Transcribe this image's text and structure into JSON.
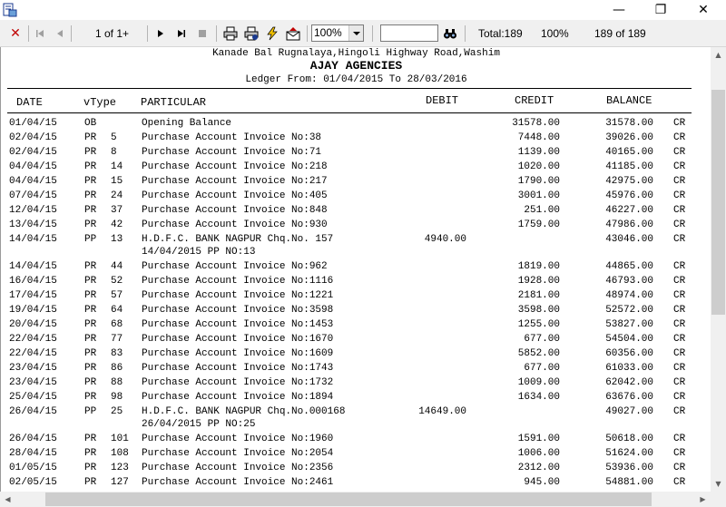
{
  "window": {
    "minimize_glyph": "—",
    "maximize_glyph": "❐",
    "close_glyph": "✕"
  },
  "toolbar": {
    "close_glyph": "✕",
    "page_indicator": "1 of 1+",
    "zoom_value": "100%",
    "search_value": "",
    "total_label": "Total:189",
    "percent_label": "100%",
    "record_label": "189 of 189"
  },
  "report": {
    "address": "Kanade Bal Rugnalaya,Hingoli Highway Road,Washim",
    "company": "AJAY AGENCIES",
    "ledger_range": "Ledger From: 01/04/2015 To 28/03/2016",
    "columns": {
      "date": "DATE",
      "vtype": "vType",
      "particular": "PARTICULAR",
      "debit": "DEBIT",
      "credit": "CREDIT",
      "balance": "BALANCE"
    },
    "rows": [
      {
        "date": "01/04/15",
        "vtype": "OB",
        "vno": "",
        "particular": "Opening Balance",
        "particular2": "",
        "debit": "",
        "credit": "31578.00",
        "balance": "31578.00",
        "drcr": "CR"
      },
      {
        "date": "02/04/15",
        "vtype": "PR",
        "vno": "5",
        "particular": "Purchase Account Invoice No:38",
        "particular2": "",
        "debit": "",
        "credit": "7448.00",
        "balance": "39026.00",
        "drcr": "CR"
      },
      {
        "date": "02/04/15",
        "vtype": "PR",
        "vno": "8",
        "particular": "Purchase Account Invoice No:71",
        "particular2": "",
        "debit": "",
        "credit": "1139.00",
        "balance": "40165.00",
        "drcr": "CR"
      },
      {
        "date": "04/04/15",
        "vtype": "PR",
        "vno": "14",
        "particular": "Purchase Account Invoice No:218",
        "particular2": "",
        "debit": "",
        "credit": "1020.00",
        "balance": "41185.00",
        "drcr": "CR"
      },
      {
        "date": "04/04/15",
        "vtype": "PR",
        "vno": "15",
        "particular": "Purchase Account Invoice No:217",
        "particular2": "",
        "debit": "",
        "credit": "1790.00",
        "balance": "42975.00",
        "drcr": "CR"
      },
      {
        "date": "07/04/15",
        "vtype": "PR",
        "vno": "24",
        "particular": "Purchase Account Invoice No:405",
        "particular2": "",
        "debit": "",
        "credit": "3001.00",
        "balance": "45976.00",
        "drcr": "CR"
      },
      {
        "date": "12/04/15",
        "vtype": "PR",
        "vno": "37",
        "particular": "Purchase Account Invoice No:848",
        "particular2": "",
        "debit": "",
        "credit": "251.00",
        "balance": "46227.00",
        "drcr": "CR"
      },
      {
        "date": "13/04/15",
        "vtype": "PR",
        "vno": "42",
        "particular": "Purchase Account Invoice No:930",
        "particular2": "",
        "debit": "",
        "credit": "1759.00",
        "balance": "47986.00",
        "drcr": "CR"
      },
      {
        "date": "14/04/15",
        "vtype": "PP",
        "vno": "13",
        "particular": "H.D.F.C. BANK NAGPUR Chq.No. 157",
        "particular2": "14/04/2015 PP NO:13",
        "debit": "4940.00",
        "credit": "",
        "balance": "43046.00",
        "drcr": "CR"
      },
      {
        "date": "14/04/15",
        "vtype": "PR",
        "vno": "44",
        "particular": "Purchase Account Invoice No:962",
        "particular2": "",
        "debit": "",
        "credit": "1819.00",
        "balance": "44865.00",
        "drcr": "CR"
      },
      {
        "date": "16/04/15",
        "vtype": "PR",
        "vno": "52",
        "particular": "Purchase Account Invoice No:1116",
        "particular2": "",
        "debit": "",
        "credit": "1928.00",
        "balance": "46793.00",
        "drcr": "CR"
      },
      {
        "date": "17/04/15",
        "vtype": "PR",
        "vno": "57",
        "particular": "Purchase Account Invoice No:1221",
        "particular2": "",
        "debit": "",
        "credit": "2181.00",
        "balance": "48974.00",
        "drcr": "CR"
      },
      {
        "date": "19/04/15",
        "vtype": "PR",
        "vno": "64",
        "particular": "Purchase Account Invoice No:3598",
        "particular2": "",
        "debit": "",
        "credit": "3598.00",
        "balance": "52572.00",
        "drcr": "CR"
      },
      {
        "date": "20/04/15",
        "vtype": "PR",
        "vno": "68",
        "particular": "Purchase Account Invoice No:1453",
        "particular2": "",
        "debit": "",
        "credit": "1255.00",
        "balance": "53827.00",
        "drcr": "CR"
      },
      {
        "date": "22/04/15",
        "vtype": "PR",
        "vno": "77",
        "particular": "Purchase Account Invoice No:1670",
        "particular2": "",
        "debit": "",
        "credit": "677.00",
        "balance": "54504.00",
        "drcr": "CR"
      },
      {
        "date": "22/04/15",
        "vtype": "PR",
        "vno": "83",
        "particular": "Purchase Account Invoice No:1609",
        "particular2": "",
        "debit": "",
        "credit": "5852.00",
        "balance": "60356.00",
        "drcr": "CR"
      },
      {
        "date": "23/04/15",
        "vtype": "PR",
        "vno": "86",
        "particular": "Purchase Account Invoice No:1743",
        "particular2": "",
        "debit": "",
        "credit": "677.00",
        "balance": "61033.00",
        "drcr": "CR"
      },
      {
        "date": "23/04/15",
        "vtype": "PR",
        "vno": "88",
        "particular": "Purchase Account Invoice No:1732",
        "particular2": "",
        "debit": "",
        "credit": "1009.00",
        "balance": "62042.00",
        "drcr": "CR"
      },
      {
        "date": "25/04/15",
        "vtype": "PR",
        "vno": "98",
        "particular": "Purchase Account Invoice No:1894",
        "particular2": "",
        "debit": "",
        "credit": "1634.00",
        "balance": "63676.00",
        "drcr": "CR"
      },
      {
        "date": "26/04/15",
        "vtype": "PP",
        "vno": "25",
        "particular": "H.D.F.C. BANK NAGPUR Chq.No.000168",
        "particular2": "26/04/2015 PP NO:25",
        "debit": "14649.00",
        "credit": "",
        "balance": "49027.00",
        "drcr": "CR"
      },
      {
        "date": "26/04/15",
        "vtype": "PR",
        "vno": "101",
        "particular": "Purchase Account Invoice No:1960",
        "particular2": "",
        "debit": "",
        "credit": "1591.00",
        "balance": "50618.00",
        "drcr": "CR"
      },
      {
        "date": "28/04/15",
        "vtype": "PR",
        "vno": "108",
        "particular": "Purchase Account Invoice No:2054",
        "particular2": "",
        "debit": "",
        "credit": "1006.00",
        "balance": "51624.00",
        "drcr": "CR"
      },
      {
        "date": "01/05/15",
        "vtype": "PR",
        "vno": "123",
        "particular": "Purchase Account Invoice No:2356",
        "particular2": "",
        "debit": "",
        "credit": "2312.00",
        "balance": "53936.00",
        "drcr": "CR"
      },
      {
        "date": "02/05/15",
        "vtype": "PR",
        "vno": "127",
        "particular": "Purchase Account Invoice No:2461",
        "particular2": "",
        "debit": "",
        "credit": "945.00",
        "balance": "54881.00",
        "drcr": "CR"
      }
    ]
  },
  "colors": {
    "close_red": "#c00000",
    "print_accent": "#1a3a8f",
    "lightning_yellow": "#f2c200",
    "scroll_thumb": "#cdcdcd"
  }
}
